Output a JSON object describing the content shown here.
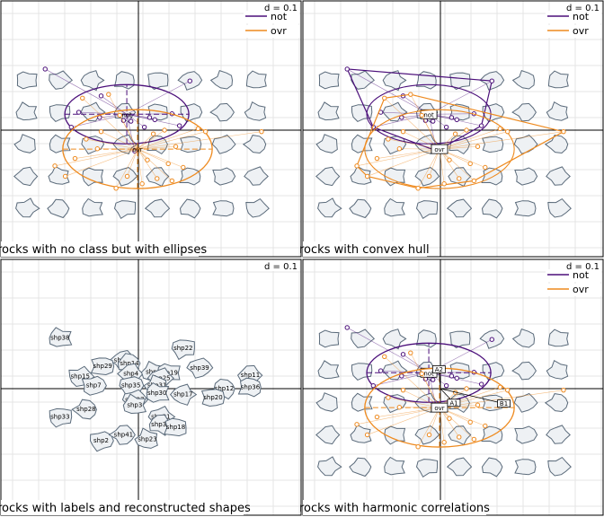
{
  "colors": {
    "not": "#4b0f7a",
    "ovr": "#ee8a1f",
    "shape_fill": "#eef1f4",
    "shape_stroke": "#5a6a7a",
    "grid": "#e4e4e4"
  },
  "panels": [
    {
      "caption": "rocks with no class but with ellipses",
      "scale": "d = 0.1",
      "legend": [
        "not",
        "ovr"
      ]
    },
    {
      "caption": "rocks with convex hull",
      "scale": "d = 0.1",
      "legend": [
        "not",
        "ovr"
      ]
    },
    {
      "caption": "rocks with labels and reconstructed shapes",
      "scale": "d = 0.1",
      "legend": []
    },
    {
      "caption": "rocks with harmonic correlations",
      "scale": "d = 0.1",
      "legend": [
        "not",
        "ovr"
      ]
    }
  ],
  "chart_data": [
    {
      "type": "scatter",
      "title": "rocks with no class but with ellipses",
      "scale_label": "d = 0.1",
      "series": [
        {
          "name": "not",
          "points": [
            [
              -1.25,
              0.82
            ],
            [
              0.69,
              0.66
            ],
            [
              -0.5,
              0.46
            ],
            [
              -0.8,
              0.24
            ],
            [
              -0.52,
              0.17
            ],
            [
              0.15,
              0.17
            ],
            [
              -0.2,
              0.13
            ],
            [
              0.08,
              0.04
            ],
            [
              -0.1,
              0.12
            ],
            [
              0.22,
              0.14
            ],
            [
              0.55,
              0.06
            ],
            [
              -0.05,
              -0.28
            ],
            [
              -0.9,
              0.04
            ],
            [
              0.45,
              0.22
            ]
          ]
        },
        {
          "name": "ovr",
          "points": [
            [
              -1.12,
              -0.48
            ],
            [
              -0.98,
              -0.62
            ],
            [
              -0.85,
              -0.38
            ],
            [
              -0.55,
              -0.25
            ],
            [
              -0.4,
              0.48
            ],
            [
              -0.25,
              0.2
            ],
            [
              0.2,
              -0.05
            ],
            [
              0.35,
              0.0
            ],
            [
              0.5,
              -0.22
            ],
            [
              0.8,
              0.02
            ],
            [
              0.9,
              -0.02
            ],
            [
              1.65,
              -0.02
            ],
            [
              -0.7,
              -0.12
            ],
            [
              -0.3,
              -0.78
            ],
            [
              -0.15,
              -0.62
            ],
            [
              0.05,
              -0.72
            ],
            [
              0.25,
              -0.65
            ],
            [
              0.45,
              -0.68
            ],
            [
              0.6,
              -0.5
            ],
            [
              0.4,
              -0.45
            ],
            [
              -0.5,
              -0.02
            ],
            [
              0.12,
              -0.4
            ],
            [
              -0.75,
              0.43
            ]
          ]
        }
      ]
    },
    {
      "type": "scatter",
      "title": "rocks with convex hull",
      "scale_label": "d = 0.1",
      "series": [
        {
          "name": "not",
          "points": [
            [
              -1.25,
              0.82
            ],
            [
              0.69,
              0.66
            ],
            [
              -0.5,
              0.46
            ],
            [
              -0.8,
              0.24
            ],
            [
              -0.52,
              0.17
            ],
            [
              0.15,
              0.17
            ],
            [
              -0.2,
              0.13
            ],
            [
              0.08,
              0.04
            ],
            [
              -0.1,
              0.12
            ],
            [
              0.22,
              0.14
            ],
            [
              0.55,
              0.06
            ],
            [
              -0.05,
              -0.28
            ],
            [
              -0.9,
              0.04
            ],
            [
              0.45,
              0.22
            ]
          ]
        },
        {
          "name": "ovr",
          "points": [
            [
              -1.12,
              -0.48
            ],
            [
              -0.98,
              -0.62
            ],
            [
              -0.85,
              -0.38
            ],
            [
              -0.55,
              -0.25
            ],
            [
              -0.4,
              0.48
            ],
            [
              -0.25,
              0.2
            ],
            [
              0.2,
              -0.05
            ],
            [
              0.35,
              0.0
            ],
            [
              0.5,
              -0.22
            ],
            [
              0.8,
              0.02
            ],
            [
              0.9,
              -0.02
            ],
            [
              1.65,
              -0.02
            ],
            [
              -0.7,
              -0.12
            ],
            [
              -0.3,
              -0.78
            ],
            [
              -0.15,
              -0.62
            ],
            [
              0.05,
              -0.72
            ],
            [
              0.25,
              -0.65
            ],
            [
              0.45,
              -0.68
            ],
            [
              0.6,
              -0.5
            ],
            [
              0.4,
              -0.45
            ],
            [
              -0.5,
              -0.02
            ],
            [
              0.12,
              -0.4
            ],
            [
              -0.75,
              0.43
            ]
          ]
        }
      ]
    },
    {
      "type": "scatter",
      "title": "rocks with labels and reconstructed shapes",
      "scale_label": "d = 0.1",
      "labels": [
        "shp38",
        "shp22",
        "shp24",
        "shp14",
        "shp29",
        "shp15",
        "shp4",
        "shp8",
        "shp19",
        "shp39",
        "shp11",
        "shp36",
        "shp7",
        "shp25",
        "shp31",
        "shp30",
        "shp35",
        "shp17",
        "shp12",
        "shp20",
        "shp27",
        "shp28",
        "shp3",
        "shp33",
        "shp21",
        "shp37",
        "shp18",
        "shp2",
        "shp41",
        "shp23"
      ],
      "points": [
        [
          -1.05,
          0.68
        ],
        [
          0.6,
          0.54
        ],
        [
          -0.2,
          0.38
        ],
        [
          -0.12,
          0.34
        ],
        [
          -0.48,
          0.3
        ],
        [
          -0.78,
          0.16
        ],
        [
          -0.1,
          0.2
        ],
        [
          0.2,
          0.22
        ],
        [
          0.4,
          0.21
        ],
        [
          0.82,
          0.28
        ],
        [
          1.5,
          0.18
        ],
        [
          1.5,
          0.02
        ],
        [
          -0.6,
          0.04
        ],
        [
          0.3,
          0.14
        ],
        [
          0.25,
          0.04
        ],
        [
          0.25,
          -0.06
        ],
        [
          -0.1,
          0.04
        ],
        [
          0.6,
          -0.08
        ],
        [
          1.15,
          0.0
        ],
        [
          1.0,
          -0.12
        ],
        [
          -0.05,
          -0.15
        ],
        [
          -0.7,
          -0.28
        ],
        [
          -0.05,
          -0.22
        ],
        [
          -1.05,
          -0.38
        ],
        [
          0.3,
          -0.38
        ],
        [
          0.3,
          -0.48
        ],
        [
          0.5,
          -0.52
        ],
        [
          -0.5,
          -0.7
        ],
        [
          -0.2,
          -0.62
        ],
        [
          0.12,
          -0.68
        ]
      ]
    },
    {
      "type": "scatter",
      "title": "rocks with harmonic correlations",
      "scale_label": "d = 0.1",
      "series": [
        {
          "name": "not",
          "points": [
            [
              -1.25,
              0.82
            ],
            [
              0.69,
              0.66
            ],
            [
              -0.5,
              0.46
            ],
            [
              -0.8,
              0.24
            ],
            [
              -0.52,
              0.17
            ],
            [
              0.15,
              0.17
            ],
            [
              -0.2,
              0.13
            ],
            [
              0.08,
              0.04
            ],
            [
              -0.1,
              0.12
            ],
            [
              0.22,
              0.14
            ],
            [
              0.55,
              0.06
            ],
            [
              -0.05,
              -0.28
            ],
            [
              -0.9,
              0.04
            ],
            [
              0.45,
              0.22
            ]
          ]
        },
        {
          "name": "ovr",
          "points": [
            [
              -1.12,
              -0.48
            ],
            [
              -0.98,
              -0.62
            ],
            [
              -0.85,
              -0.38
            ],
            [
              -0.55,
              -0.25
            ],
            [
              -0.4,
              0.48
            ],
            [
              -0.25,
              0.2
            ],
            [
              0.2,
              -0.05
            ],
            [
              0.35,
              0.0
            ],
            [
              0.5,
              -0.22
            ],
            [
              0.8,
              0.02
            ],
            [
              0.9,
              -0.02
            ],
            [
              1.65,
              -0.02
            ],
            [
              -0.7,
              -0.12
            ],
            [
              -0.3,
              -0.78
            ],
            [
              -0.15,
              -0.62
            ],
            [
              0.05,
              -0.72
            ],
            [
              0.25,
              -0.65
            ],
            [
              0.45,
              -0.68
            ],
            [
              0.6,
              -0.5
            ],
            [
              0.4,
              -0.45
            ],
            [
              -0.5,
              -0.02
            ],
            [
              0.12,
              -0.4
            ],
            [
              -0.75,
              0.43
            ]
          ]
        }
      ],
      "correlation_boxes": [
        "not",
        "ovr",
        "A1",
        "A2",
        "B1"
      ]
    }
  ]
}
